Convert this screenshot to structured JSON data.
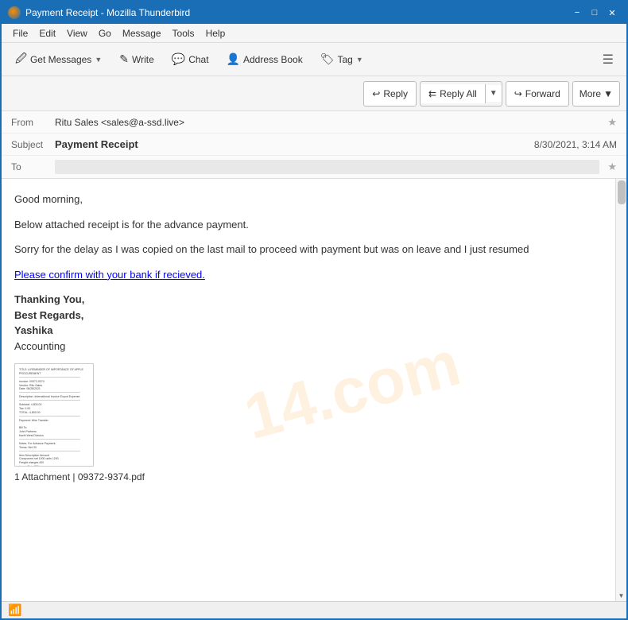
{
  "window": {
    "title": "Payment Receipt - Mozilla Thunderbird"
  },
  "menu": {
    "items": [
      "File",
      "Edit",
      "View",
      "Go",
      "Message",
      "Tools",
      "Help"
    ]
  },
  "toolbar": {
    "get_messages_label": "Get Messages",
    "write_label": "Write",
    "chat_label": "Chat",
    "address_book_label": "Address Book",
    "tag_label": "Tag"
  },
  "actions": {
    "reply_label": "Reply",
    "reply_all_label": "Reply All",
    "forward_label": "Forward",
    "more_label": "More"
  },
  "email": {
    "from_label": "From",
    "from_name": "Ritu Sales",
    "from_email": "sales@a-ssd.live",
    "subject_label": "Subject",
    "subject_value": "Payment Receipt",
    "to_label": "To",
    "date": "8/30/2021, 3:14 AM"
  },
  "body": {
    "greeting": "Good morning,",
    "para1": "Below attached receipt is for the advance payment.",
    "para2": "Sorry for the delay as I was copied on the last mail to proceed with payment but was on leave and I just resumed",
    "para3": "Please confirm with your bank if recieved.",
    "signature_line1": "Thanking You,",
    "signature_line2": "Best Regards,",
    "signature_line3": "Yashika",
    "signature_line4": "Accounting"
  },
  "attachment": {
    "info": "1 Attachment | 09372-9374.pdf"
  },
  "watermark": "14.com",
  "status": {
    "wifi_icon": "📶"
  }
}
